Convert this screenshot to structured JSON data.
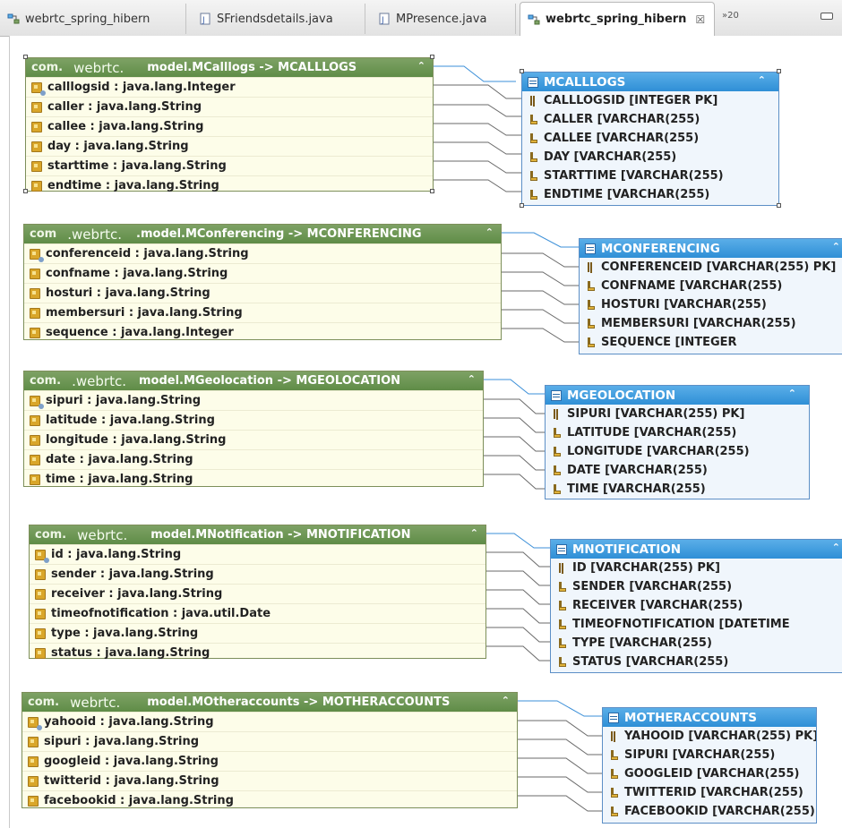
{
  "tabs": [
    {
      "label": "webrtc_spring_hibern",
      "icon": "diagram-icon",
      "active": false
    },
    {
      "label": "SFriendsdetails.java",
      "icon": "java-file-icon",
      "active": false
    },
    {
      "label": "MPresence.java",
      "icon": "java-file-icon",
      "active": false
    },
    {
      "label": "webrtc_spring_hibern",
      "icon": "diagram-icon",
      "active": true,
      "close": "☒"
    }
  ],
  "overflow_indicator": "»20",
  "mappings": [
    {
      "class": {
        "pkg": "com.",
        "webrtc": "webrtc.",
        "name": "model.MCalllogs -> MCALLLOGS",
        "fields": [
          "calllogsid : java.lang.Integer",
          "caller : java.lang.String",
          "callee : java.lang.String",
          "day : java.lang.String",
          "starttime : java.lang.String",
          "endtime : java.lang.String"
        ]
      },
      "table": {
        "name": "MCALLLOGS",
        "columns": [
          "CALLLOGSID [INTEGER PK]",
          "CALLER [VARCHAR(255)",
          "CALLEE [VARCHAR(255)",
          "DAY [VARCHAR(255)",
          "STARTTIME [VARCHAR(255)",
          "ENDTIME [VARCHAR(255)"
        ]
      }
    },
    {
      "class": {
        "pkg": "com",
        "webrtc": ".webrtc.",
        "name": ".model.MConferencing -> MCONFERENCING",
        "fields": [
          "conferenceid : java.lang.String",
          "confname : java.lang.String",
          "hosturi : java.lang.String",
          "membersuri : java.lang.String",
          "sequence : java.lang.Integer"
        ]
      },
      "table": {
        "name": "MCONFERENCING",
        "columns": [
          "CONFERENCEID [VARCHAR(255) PK]",
          "CONFNAME [VARCHAR(255)",
          "HOSTURI [VARCHAR(255)",
          "MEMBERSURI [VARCHAR(255)",
          "SEQUENCE [INTEGER"
        ]
      }
    },
    {
      "class": {
        "pkg": "com.",
        "webrtc": ".webrtc.",
        "name": "model.MGeolocation -> MGEOLOCATION",
        "fields": [
          "sipuri : java.lang.String",
          "latitude : java.lang.String",
          "longitude : java.lang.String",
          "date : java.lang.String",
          "time : java.lang.String"
        ]
      },
      "table": {
        "name": "MGEOLOCATION",
        "columns": [
          "SIPURI [VARCHAR(255) PK]",
          "LATITUDE [VARCHAR(255)",
          "LONGITUDE [VARCHAR(255)",
          "DATE [VARCHAR(255)",
          "TIME [VARCHAR(255)"
        ]
      }
    },
    {
      "class": {
        "pkg": "com.",
        "webrtc": "webrtc.",
        "name": "model.MNotification -> MNOTIFICATION",
        "fields": [
          "id : java.lang.String",
          "sender : java.lang.String",
          "receiver : java.lang.String",
          "timeofnotification : java.util.Date",
          "type : java.lang.String",
          "status : java.lang.String"
        ]
      },
      "table": {
        "name": "MNOTIFICATION",
        "columns": [
          "ID [VARCHAR(255) PK]",
          "SENDER [VARCHAR(255)",
          "RECEIVER [VARCHAR(255)",
          "TIMEOFNOTIFICATION [DATETIME",
          "TYPE [VARCHAR(255)",
          "STATUS [VARCHAR(255)"
        ]
      }
    },
    {
      "class": {
        "pkg": "com.",
        "webrtc": "webrtc.",
        "name": "model.MOtheraccounts -> MOTHERACCOUNTS",
        "fields": [
          "yahooid : java.lang.String",
          "sipuri : java.lang.String",
          "googleid : java.lang.String",
          "twitterid : java.lang.String",
          "facebookid : java.lang.String"
        ]
      },
      "table": {
        "name": "MOTHERACCOUNTS",
        "columns": [
          "YAHOOID [VARCHAR(255) PK]",
          "SIPURI [VARCHAR(255)",
          "GOOGLEID [VARCHAR(255)",
          "TWITTERID [VARCHAR(255)",
          "FACEBOOKID [VARCHAR(255)"
        ]
      }
    }
  ],
  "collapse_glyph": "⌃"
}
